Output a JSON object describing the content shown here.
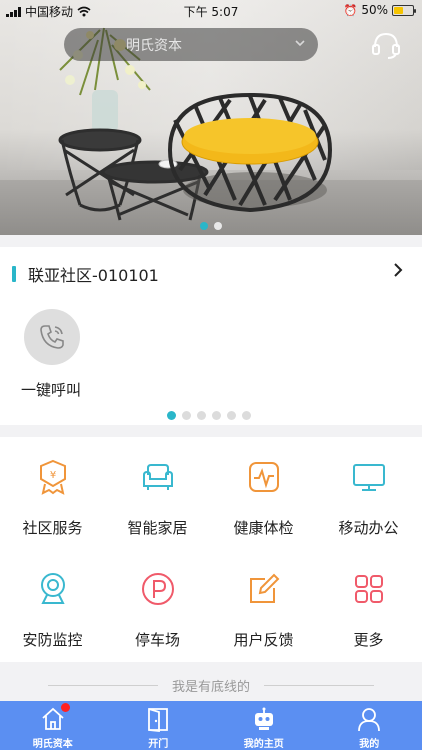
{
  "status_bar": {
    "carrier": "中国移动",
    "time": "下午 5:07",
    "battery_percent": "50%",
    "battery_level": 0.5
  },
  "top": {
    "community_selector": "明氏资本",
    "headset_icon": "headset-icon"
  },
  "banner": {
    "page_count": 2,
    "active_index": 0
  },
  "community": {
    "name": "联亚社区-010101",
    "call_label": "一键呼叫",
    "pager_count": 6,
    "pager_active": 0
  },
  "services": [
    {
      "label": "社区服务",
      "icon": "community-service-icon",
      "color": "#f0953a"
    },
    {
      "label": "智能家居",
      "icon": "sofa-icon",
      "color": "#39b8cf"
    },
    {
      "label": "健康体检",
      "icon": "heartbeat-icon",
      "color": "#f0953a"
    },
    {
      "label": "移动办公",
      "icon": "monitor-icon",
      "color": "#39b8cf"
    },
    {
      "label": "安防监控",
      "icon": "webcam-icon",
      "color": "#39b8cf"
    },
    {
      "label": "停车场",
      "icon": "parking-icon",
      "color": "#f05a6a"
    },
    {
      "label": "用户反馈",
      "icon": "edit-icon",
      "color": "#f0953a"
    },
    {
      "label": "更多",
      "icon": "grid-more-icon",
      "color": "#f05a6a"
    }
  ],
  "footer_note": "我是有底线的",
  "tabs": [
    {
      "label": "明氏资本",
      "icon": "home-icon",
      "badge": true
    },
    {
      "label": "开门",
      "icon": "door-icon",
      "badge": false
    },
    {
      "label": "我的主页",
      "icon": "robot-icon",
      "badge": false
    },
    {
      "label": "我的",
      "icon": "user-icon",
      "badge": false
    }
  ],
  "colors": {
    "accent": "#2ab6c9",
    "tabbar": "#5b8ff2"
  }
}
